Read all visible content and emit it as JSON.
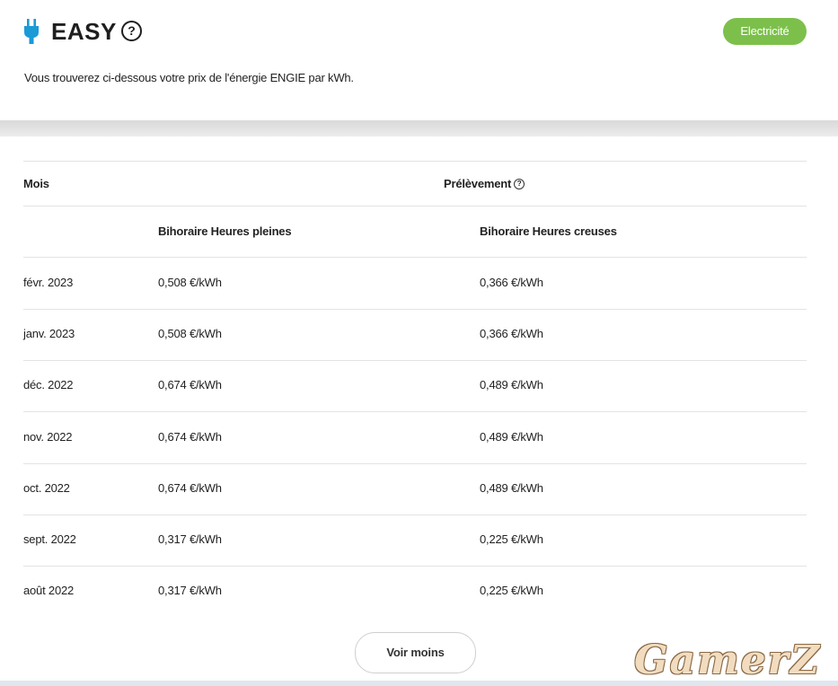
{
  "header": {
    "title": "EASY",
    "help_glyph": "?",
    "badge": "Electricité",
    "subtitle": "Vous trouverez ci-dessous votre prix de l'énergie ENGIE par kWh.",
    "icon": "plug-icon"
  },
  "table": {
    "col_month": "Mois",
    "col_prelevement": "Prélèvement",
    "help_glyph": "?",
    "sub_full": "Bihoraire Heures pleines",
    "sub_off": "Bihoraire Heures creuses",
    "rows": [
      {
        "month": "févr. 2023",
        "full": "0,508 €/kWh",
        "off": "0,366 €/kWh"
      },
      {
        "month": "janv. 2023",
        "full": "0,508 €/kWh",
        "off": "0,366 €/kWh"
      },
      {
        "month": "déc. 2022",
        "full": "0,674 €/kWh",
        "off": "0,489 €/kWh"
      },
      {
        "month": "nov. 2022",
        "full": "0,674 €/kWh",
        "off": "0,489 €/kWh"
      },
      {
        "month": "oct. 2022",
        "full": "0,674 €/kWh",
        "off": "0,489 €/kWh"
      },
      {
        "month": "sept. 2022",
        "full": "0,317 €/kWh",
        "off": "0,225 €/kWh"
      },
      {
        "month": "août 2022",
        "full": "0,317 €/kWh",
        "off": "0,225 €/kWh"
      }
    ]
  },
  "actions": {
    "show_less": "Voir moins"
  },
  "watermark": "GamerZ",
  "colors": {
    "accent_green": "#7cc04b",
    "plug_blue": "#1a9ad6"
  }
}
